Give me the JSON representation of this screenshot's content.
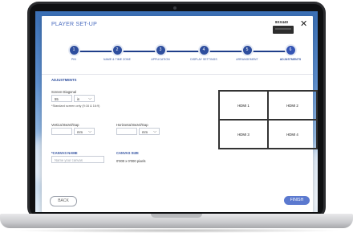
{
  "modal": {
    "title": "PLAYER SET-UP",
    "device_label": "8XX440",
    "close_glyph": "✕"
  },
  "steps": [
    {
      "number": "1",
      "label": "PIN"
    },
    {
      "number": "2",
      "label": "NAME & TIME ZONE"
    },
    {
      "number": "3",
      "label": "APPLICATION"
    },
    {
      "number": "4",
      "label": "DISPLAY SETTINGS"
    },
    {
      "number": "5",
      "label": "ARRANGEMENT"
    },
    {
      "number": "6",
      "label": "ADJUSTMENTS"
    }
  ],
  "active_step": 6,
  "adjustments": {
    "section_title": "ADJUSTMENTS",
    "screen_diagonal": {
      "label": "Screen Diagonal",
      "value": "55",
      "unit": "in",
      "note": "*Standard screen only (9:16 & 16:9)"
    },
    "vertical_bezel": {
      "label": "Vertical Bezel/Gap",
      "value": "",
      "unit": "mm"
    },
    "horizontal_bezel": {
      "label": "Horizontal Bezel/Gap",
      "value": "",
      "unit": "mm"
    },
    "canvas_name": {
      "label": "*CANVAS NAME",
      "placeholder": "Name your canvas"
    },
    "canvas_size": {
      "label": "CANVAS SIZE",
      "value": "0'000 x 0'000 pixels"
    }
  },
  "hdmi_grid": [
    "HDMI 1",
    "HDMI 2",
    "HDMI 3",
    "HDMI 4"
  ],
  "buttons": {
    "back": "BACK",
    "finish": "FINISH"
  },
  "icons": {
    "close": "close-icon",
    "chevron": "chevron-down-icon",
    "device": "player-device-icon"
  },
  "colors": {
    "accent": "#2e4e9e",
    "finish_button": "#5b79cf"
  }
}
